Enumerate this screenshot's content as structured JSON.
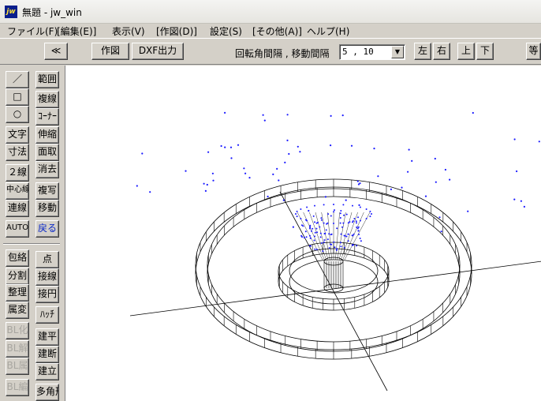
{
  "window": {
    "title": "無題 - jw_win",
    "icon_text": "jw"
  },
  "menu": [
    "ファイル(F)",
    "[編集(E)]",
    "表示(V)",
    "[作図(D)]",
    "設定(S)",
    "[その他(A)]",
    "ヘルプ(H)"
  ],
  "toolbar": {
    "back_label": "≪",
    "draw_label": "作図",
    "dxf_label": "DXF出力",
    "rotation_label": "回転角間隔 , 移動間隔",
    "interval_value": "5 , 10",
    "left_label": "左",
    "right_label": "右",
    "up_label": "上",
    "down_label": "下",
    "partial_label": "等"
  },
  "tools": {
    "c1": [
      "／",
      "□",
      "○",
      "文字",
      "寸法",
      "２線",
      "中心線",
      "連線",
      "AUTO"
    ],
    "c2": [
      "範囲",
      "複線",
      "ｺｰﾅｰ",
      "伸縮",
      "面取",
      "消去",
      "複写",
      "移動",
      "戻る"
    ],
    "c3": [
      "包絡",
      "分割",
      "整理",
      "属変",
      "BL化",
      "BL解",
      "BL属",
      "BL編"
    ],
    "c4": [
      "点",
      "接線",
      "接円",
      "ﾊｯﾁ",
      "建平",
      "建断",
      "建立",
      "多角形"
    ]
  },
  "colors": {
    "face": "#d4d0c8",
    "canvas": "#ffffff",
    "points": "#1a1aff",
    "lines": "#000000",
    "accent": "#0a28c8"
  }
}
